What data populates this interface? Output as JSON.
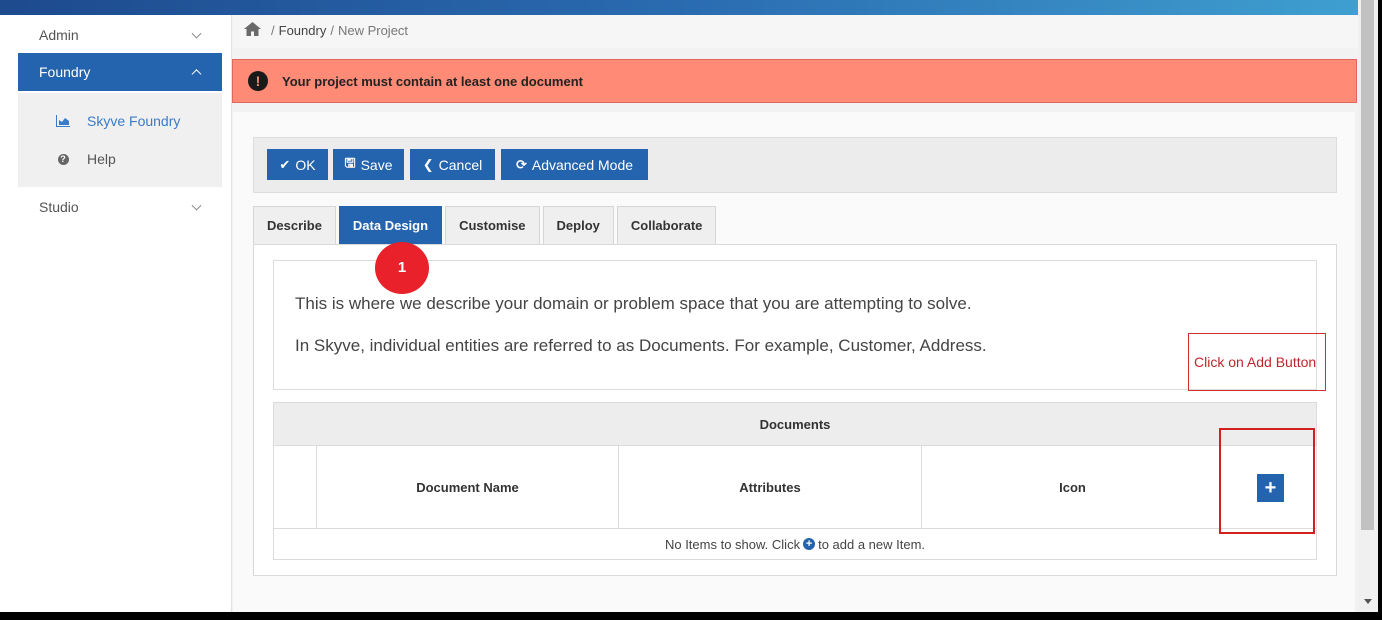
{
  "sidebar": {
    "items": [
      {
        "label": "Admin"
      },
      {
        "label": "Foundry"
      },
      {
        "label": "Studio"
      }
    ],
    "submenu": [
      {
        "label": "Skyve Foundry",
        "icon": "chart-icon"
      },
      {
        "label": "Help",
        "icon": "question-circle-icon"
      }
    ]
  },
  "breadcrumb": {
    "home_icon": "home-icon",
    "sep1": "/",
    "section": "Foundry",
    "sep2": "/",
    "current": "New Project"
  },
  "alert": {
    "icon": "!",
    "message": "Your project must contain at least one document"
  },
  "toolbar": {
    "ok_icon": "✔",
    "ok_label": "OK",
    "save_icon": "🖫",
    "save_label": "Save",
    "cancel_icon": "❮",
    "cancel_label": "Cancel",
    "advanced_icon": "⟳",
    "advanced_label": "Advanced Mode"
  },
  "tabs": [
    {
      "label": "Describe"
    },
    {
      "label": "Data Design"
    },
    {
      "label": "Customise"
    },
    {
      "label": "Deploy"
    },
    {
      "label": "Collaborate"
    }
  ],
  "description": {
    "line1": "This is where we describe your domain or problem space that you are attempting to solve.",
    "line2": "In Skyve, individual entities are referred to as Documents. For example, Customer, Address."
  },
  "grid": {
    "title": "Documents",
    "columns": [
      "Document Name",
      "Attributes",
      "Icon"
    ],
    "add_label": "+",
    "empty_before": "No Items to show. Click",
    "empty_icon": "+",
    "empty_after": "to add a new Item."
  },
  "annotations": {
    "step_number": "1",
    "callout": "Click on Add Button"
  },
  "colors": {
    "primary": "#2463ad",
    "alert_bg": "#ff8a76",
    "annotation_red": "#e8212b"
  }
}
